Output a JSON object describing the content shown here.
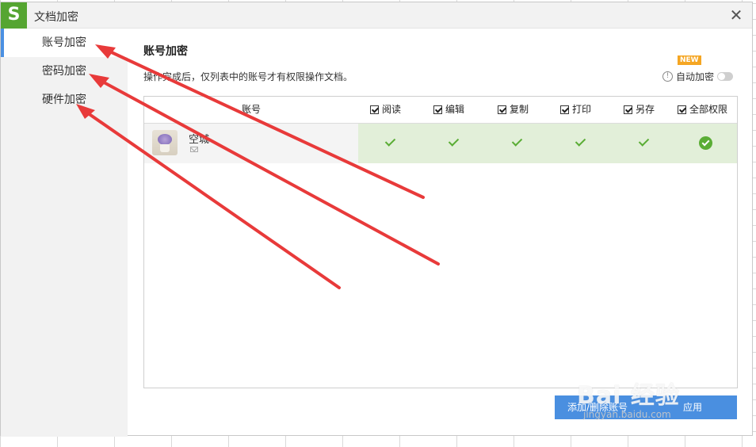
{
  "window": {
    "title": "文档加密",
    "logo_letter": "S"
  },
  "sidebar": {
    "items": [
      {
        "label": "账号加密",
        "active": true
      },
      {
        "label": "密码加密",
        "active": false
      },
      {
        "label": "硬件加密",
        "active": false
      }
    ]
  },
  "main": {
    "section_title": "账号加密",
    "description": "操作完成后，仅列表中的账号才有权限操作文档。",
    "badge": "NEW",
    "auto_encrypt_label": "自动加密",
    "auto_encrypt_on": false
  },
  "table": {
    "account_header": "账号",
    "permission_headers": [
      "阅读",
      "编辑",
      "复制",
      "打印",
      "另存",
      "全部权限"
    ],
    "rows": [
      {
        "name": "空城",
        "permissions": [
          true,
          true,
          true,
          true,
          true,
          true
        ]
      }
    ]
  },
  "buttons": {
    "add_remove": "添加/删除账号",
    "apply": "应用"
  },
  "watermark": {
    "main": "Bai 经验",
    "sub": "jingyan.baidu.com"
  },
  "colors": {
    "brand_green": "#55a531",
    "accent_blue": "#4a8fe0",
    "check_green": "#5aad35",
    "row_highlight": "#e2efd9",
    "badge_orange": "#f5a623",
    "arrow_red": "#e83a3a"
  }
}
